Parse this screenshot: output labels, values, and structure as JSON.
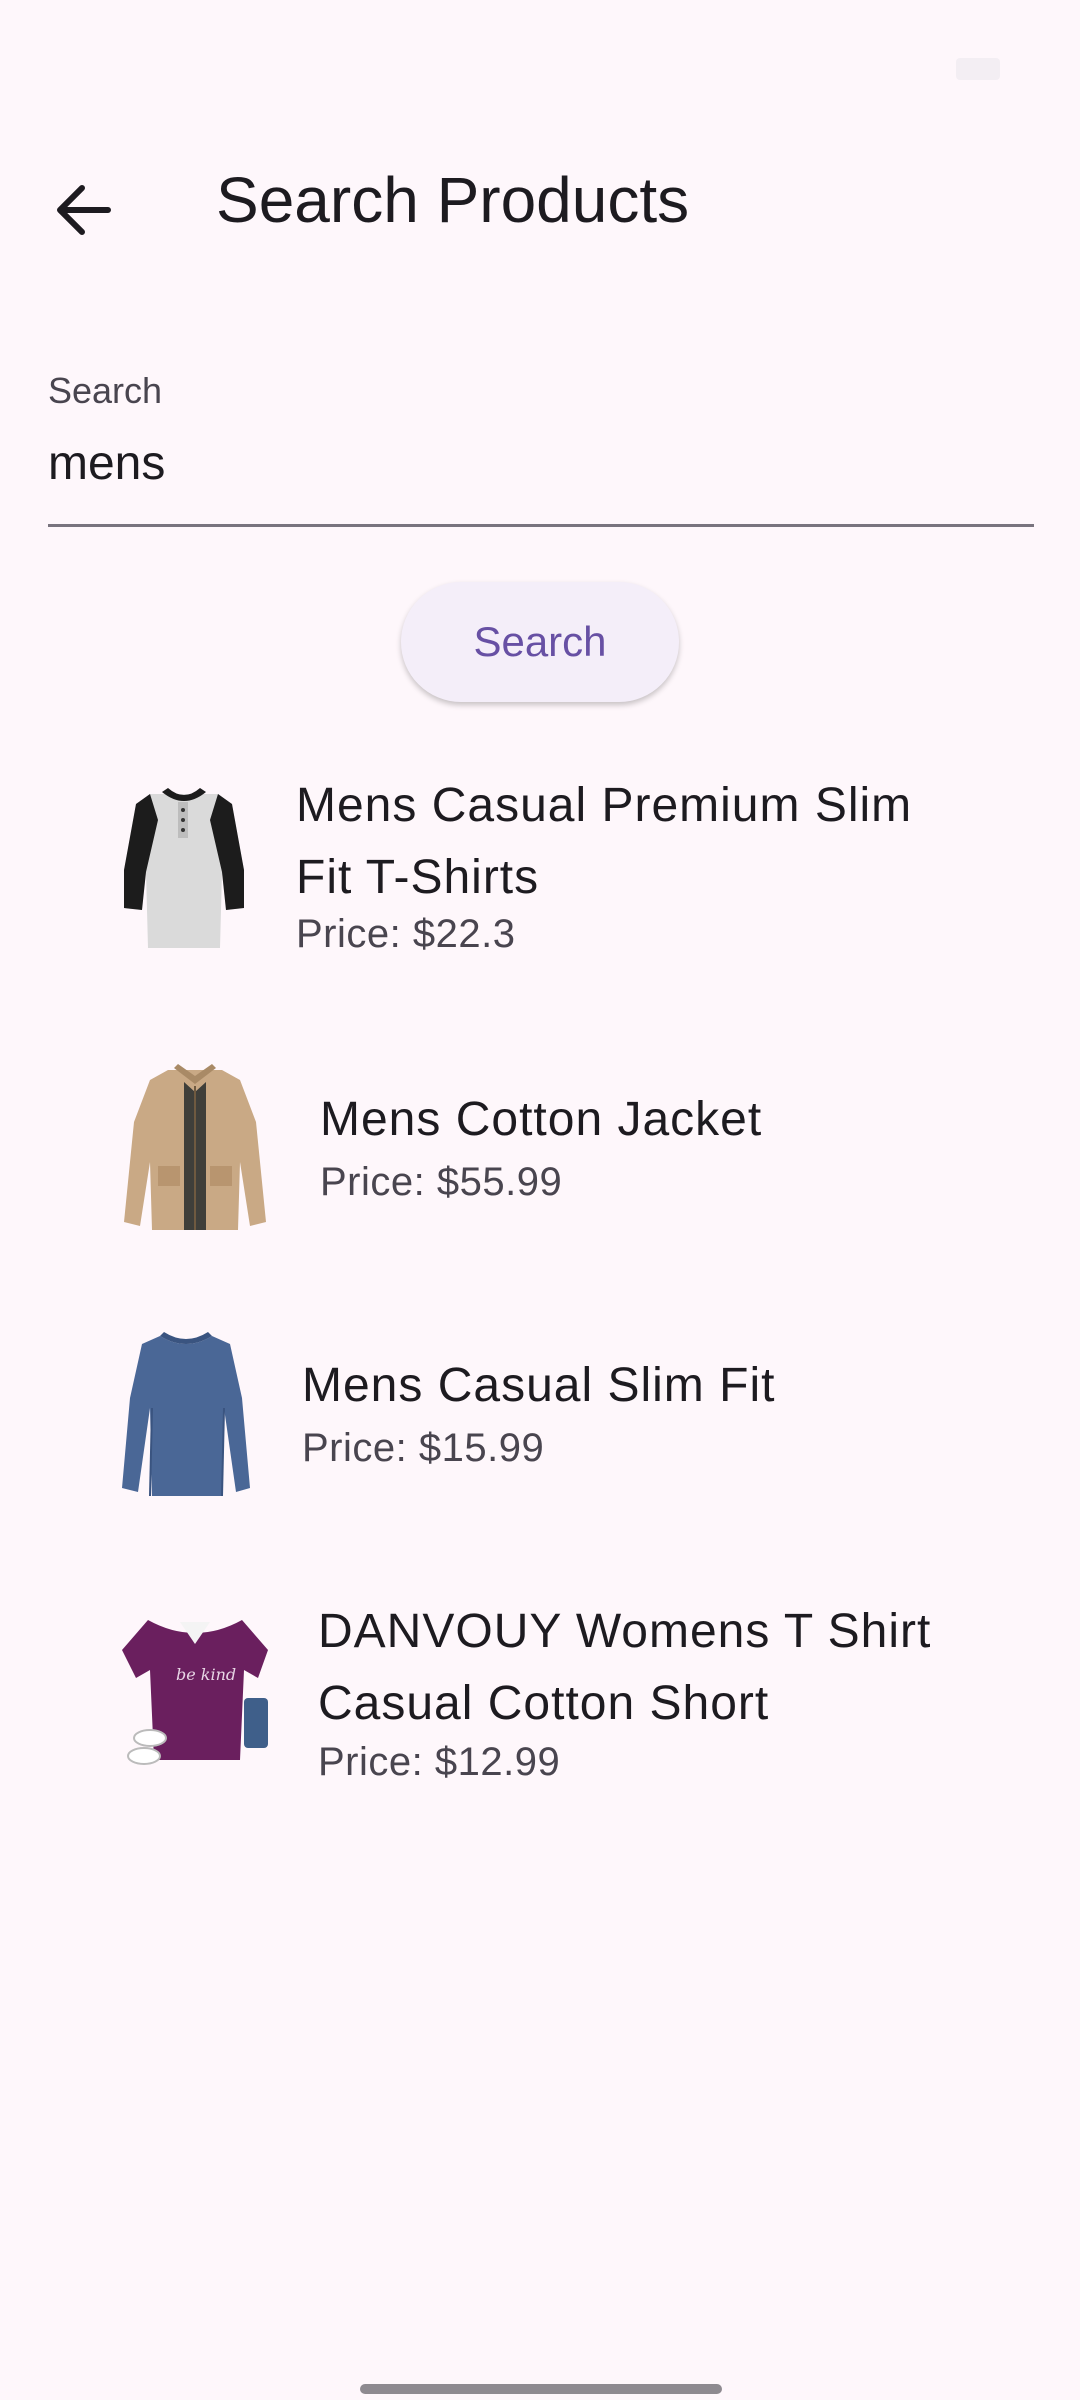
{
  "header": {
    "title": "Search Products",
    "back_icon": "arrow-back-icon"
  },
  "search": {
    "label": "Search",
    "value": "mens",
    "button_label": "Search"
  },
  "products": [
    {
      "name": "Mens Casual Premium Slim Fit T-Shirts",
      "price": "Price: $22.3",
      "image_icon": "raglan-henley-tshirt-image"
    },
    {
      "name": "Mens Cotton Jacket",
      "price": "Price: $55.99",
      "image_icon": "khaki-cotton-jacket-image"
    },
    {
      "name": "Mens Casual Slim Fit",
      "price": "Price: $15.99",
      "image_icon": "blue-long-sleeve-shirt-image"
    },
    {
      "name": "DANVOUY Womens T Shirt Casual Cotton Short",
      "price": "Price: $12.99",
      "image_icon": "purple-be-kind-tshirt-image",
      "image_text": "be kind"
    }
  ],
  "colors": {
    "background": "#fef7fb",
    "accent": "#6750a4",
    "button_bg": "#f4eef9"
  }
}
